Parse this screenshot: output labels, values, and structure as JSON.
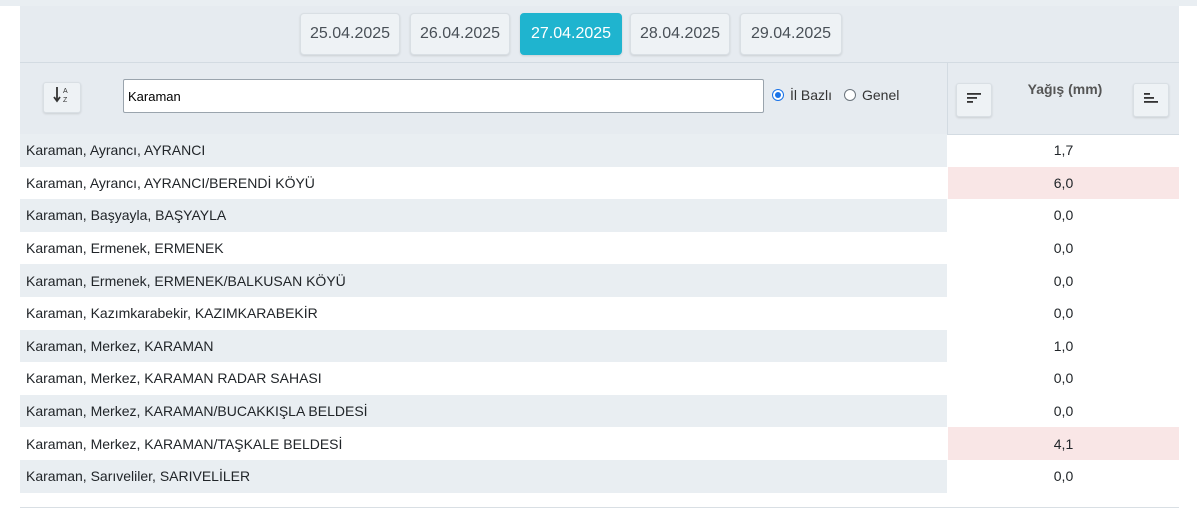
{
  "dates": [
    {
      "label": "25.04.2025",
      "active": false
    },
    {
      "label": "26.04.2025",
      "active": false
    },
    {
      "label": "27.04.2025",
      "active": true
    },
    {
      "label": "28.04.2025",
      "active": false
    },
    {
      "label": "29.04.2025",
      "active": false
    }
  ],
  "search": {
    "value": "Karaman"
  },
  "radios": [
    {
      "label": "İl Bazlı",
      "checked": true
    },
    {
      "label": "Genel",
      "checked": false
    }
  ],
  "column_title": "Yağış (mm)",
  "rows": [
    {
      "name": "Karaman, Ayrancı, AYRANCI",
      "value": "1,7",
      "highlight": false
    },
    {
      "name": "Karaman, Ayrancı, AYRANCI/BERENDİ KÖYÜ",
      "value": "6,0",
      "highlight": true
    },
    {
      "name": "Karaman, Başyayla, BAŞYAYLA",
      "value": "0,0",
      "highlight": false
    },
    {
      "name": "Karaman, Ermenek, ERMENEK",
      "value": "0,0",
      "highlight": false
    },
    {
      "name": "Karaman, Ermenek, ERMENEK/BALKUSAN KÖYÜ",
      "value": "0,0",
      "highlight": false
    },
    {
      "name": "Karaman, Kazımkarabekir, KAZIMKARABEKİR",
      "value": "0,0",
      "highlight": false
    },
    {
      "name": "Karaman, Merkez, KARAMAN",
      "value": "1,0",
      "highlight": false
    },
    {
      "name": "Karaman, Merkez, KARAMAN RADAR SAHASI",
      "value": "0,0",
      "highlight": false
    },
    {
      "name": "Karaman, Merkez, KARAMAN/BUCAKKIŞLA BELDESİ",
      "value": "0,0",
      "highlight": false
    },
    {
      "name": "Karaman, Merkez, KARAMAN/TAŞKALE BELDESİ",
      "value": "4,1",
      "highlight": true
    },
    {
      "name": "Karaman, Sarıveliler, SARIVELİLER",
      "value": "0,0",
      "highlight": false
    }
  ],
  "colors": {
    "accent": "#1fb4cf",
    "highlight": "#f9e6e6",
    "stripe": "#e9eef2"
  },
  "icons": {
    "sort_alpha": "sort-alpha-icon",
    "sort_desc": "sort-descending-icon",
    "sort_asc": "sort-ascending-icon"
  }
}
